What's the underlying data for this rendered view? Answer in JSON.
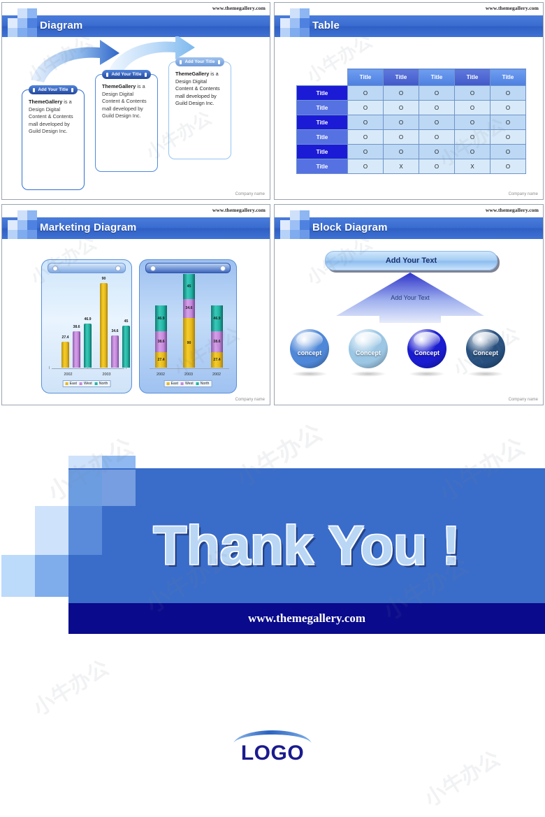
{
  "common": {
    "url": "www.themegallery.com",
    "company_footer": "Company name",
    "watermark": "小牛办公"
  },
  "slides": [
    {
      "id": "diagram",
      "title": "Diagram",
      "boxes": [
        {
          "cap": "Add Your Title",
          "bold": "ThemeGallery",
          "text": " is a Design Digital Content & Contents mall developed by Guild Design Inc."
        },
        {
          "cap": "Add Your Title",
          "bold": "ThemeGallery",
          "text": " is a Design Digital Content & Contents mall developed by Guild Design Inc."
        },
        {
          "cap": "Add Your Title",
          "bold": "ThemeGallery",
          "text": " is a Design Digital Content & Contents mall developed by Guild Design Inc."
        }
      ]
    },
    {
      "id": "table",
      "title": "Table",
      "table": {
        "col_headers": [
          "Title",
          "Title",
          "Title",
          "Title",
          "Title"
        ],
        "row_headers": [
          "Title",
          "Title",
          "Title",
          "Title",
          "Title",
          "Title"
        ],
        "rows": [
          [
            "O",
            "O",
            "O",
            "O",
            "O"
          ],
          [
            "O",
            "O",
            "O",
            "O",
            "O"
          ],
          [
            "O",
            "O",
            "O",
            "O",
            "O"
          ],
          [
            "O",
            "O",
            "O",
            "O",
            "O"
          ],
          [
            "O",
            "O",
            "O",
            "O",
            "O"
          ],
          [
            "O",
            "X",
            "O",
            "X",
            "O"
          ]
        ]
      }
    },
    {
      "id": "marketing-diagram",
      "title": "Marketing Diagram"
    },
    {
      "id": "block-diagram",
      "title": "Block Diagram",
      "pill_label": "Add Your Text",
      "arrow_label": "Add Your Text",
      "spheres": [
        {
          "label": "concept",
          "color": "#4f88d8"
        },
        {
          "label": "Concept",
          "color": "#9bc6e4"
        },
        {
          "label": "Concept",
          "color": "#1a1ccf"
        },
        {
          "label": "Concept",
          "color": "#27507f"
        }
      ]
    }
  ],
  "chart_data": [
    {
      "type": "bar",
      "title": "",
      "subtype": "clustered",
      "categories": [
        "2002",
        "2003"
      ],
      "series": [
        {
          "name": "East",
          "values": [
            27.4,
            90
          ],
          "color": "#e6b91c"
        },
        {
          "name": "West",
          "values": [
            38.6,
            34.6
          ],
          "color": "#c489dc"
        },
        {
          "name": "North",
          "values": [
            46.9,
            45
          ],
          "color": "#21b3a3"
        }
      ],
      "legend": [
        "East",
        "West",
        "North"
      ],
      "legend_position": "bottom",
      "ylim": [
        0,
        100
      ],
      "grid": false,
      "xlabel": "",
      "ylabel": ""
    },
    {
      "type": "bar",
      "title": "",
      "subtype": "stacked",
      "categories": [
        "2002",
        "2003",
        "2002"
      ],
      "series": [
        {
          "name": "East",
          "values": [
            27.4,
            90,
            27.4
          ],
          "color": "#e6b91c"
        },
        {
          "name": "West",
          "values": [
            38.6,
            34.6,
            38.6
          ],
          "color": "#c489dc"
        },
        {
          "name": "North",
          "values": [
            46.9,
            45,
            46.9
          ],
          "color": "#21b3a3"
        }
      ],
      "legend": [
        "East",
        "West",
        "North"
      ],
      "legend_position": "bottom",
      "ylim": [
        0,
        170
      ],
      "grid": false,
      "xlabel": "",
      "ylabel": ""
    }
  ],
  "thank_you": {
    "title": "Thank You !",
    "url": "www.themegallery.com"
  },
  "logo": {
    "text": "LOGO",
    "arc_color": "#3a73c8"
  }
}
